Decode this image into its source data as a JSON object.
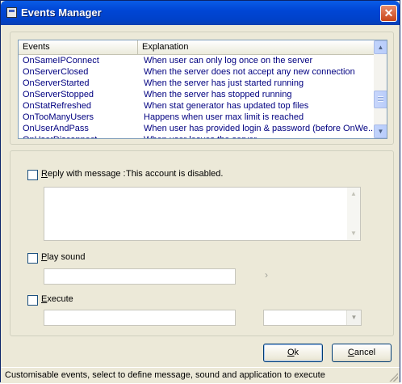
{
  "window": {
    "title": "Events Manager",
    "close_glyph": "✕"
  },
  "events": {
    "columns": [
      "Events",
      "Explanation"
    ],
    "rows": [
      {
        "event": "OnSameIPConnect",
        "explanation": "When user can only log once on the server"
      },
      {
        "event": "OnServerClosed",
        "explanation": "When the server does not accept any new connection"
      },
      {
        "event": "OnServerStarted",
        "explanation": "When the server has just started running"
      },
      {
        "event": "OnServerStopped",
        "explanation": "When the server has stopped running"
      },
      {
        "event": "OnStatRefreshed",
        "explanation": "When stat generator has updated top files"
      },
      {
        "event": "OnTooManyUsers",
        "explanation": "Happens when user max limit is reached"
      },
      {
        "event": "OnUserAndPass",
        "explanation": "When user has provided login & password (before OnWe..."
      },
      {
        "event": "OnUserDisconnect",
        "explanation": "When user leaves the server"
      }
    ]
  },
  "reply": {
    "label_prefix": "R",
    "label_rest": "eply with message :",
    "message": "This account is disabled.",
    "checked": false
  },
  "sound": {
    "label_prefix": "P",
    "label_rest": "lay sound",
    "checked": false,
    "browse_glyph": "›"
  },
  "execute": {
    "label_prefix": "E",
    "label_rest": "xecute",
    "checked": false
  },
  "buttons": {
    "ok_prefix": "O",
    "ok_rest": "k",
    "cancel_prefix": "C",
    "cancel_rest": "ancel"
  },
  "status": "Customisable events, select to define message, sound and application to execute",
  "icons": {
    "up": "▲",
    "down": "▼",
    "combo_arrow": "▼"
  }
}
